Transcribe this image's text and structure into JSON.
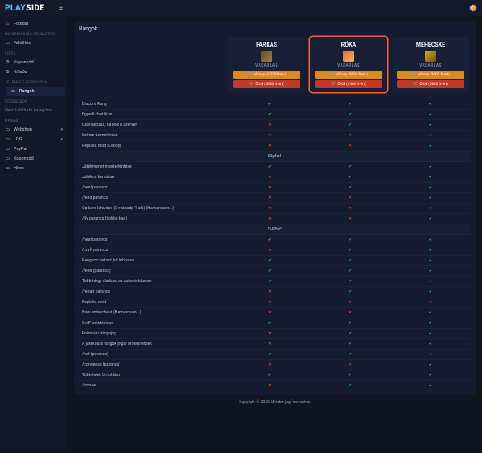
{
  "app": {
    "logo_a": "PLAY",
    "logo_b": "SIDE"
  },
  "sidebar": {
    "home": "Főoldal",
    "sec_info": "INFORMÁCIÓS FELÜLETEK",
    "feltoltes": "Feltöltés",
    "sec_lista": "LISTA",
    "kupon": "Kuponkód",
    "kulsos": "Külsős",
    "sec_kerdes": "JELENLEG KERESED A",
    "rangok": "Rangok",
    "sec_kategoria": "KERESÉSEK",
    "nem_talalhato": "Nem található kategória",
    "sec_vasar": "HASÁB",
    "webshop": "Webshop",
    "log": "LOG",
    "paypal": "PayPal",
    "kuponkod": "Kuponkód",
    "hirek": "Hírek"
  },
  "page": {
    "title": "Rangok"
  },
  "ranks": [
    {
      "name": "FARKAS",
      "sub": "VÁSÁRLÁS",
      "btn1": "60 nap (1500 ft-ért)",
      "btn2": "Örök (3400 ft-ért)"
    },
    {
      "name": "RÓKA",
      "sub": "VÁSÁRLÁS",
      "btn1": "60 nap (2000 ft-ért)",
      "btn2": "Örök (3400 ft-ért)"
    },
    {
      "name": "MÉHECSKE",
      "sub": "VÁSÁRLÁS",
      "btn1": "60 nap (3000 ft-ért)",
      "btn2": "Örök (5800 ft-ért)"
    }
  ],
  "rows1": [
    "Discord Rang",
    "Egyedi chat ikon",
    "Csatlakozás, ha tele a szerver",
    "Színes üzenet írása",
    "Repülés mód (Lobby)"
  ],
  "vals1": [
    [
      "y",
      "y",
      "y"
    ],
    [
      "y",
      "y",
      "y"
    ],
    [
      "n",
      "y",
      "y"
    ],
    [
      "n",
      "n",
      "y"
    ],
    [
      "n",
      "n",
      "y"
    ]
  ],
  "sec2": "SkyFall",
  "rows2": [
    "Játékmenet megterkintése",
    "Játékos keresése",
    "/heal parancs",
    "/feed parancs",
    "Op kard lehívása (5 másodp 1 alk) (Hamarosan...)",
    "/fly parancs (Lobby-ban)"
  ],
  "vals2": [
    [
      "y",
      "y",
      "y"
    ],
    [
      "n",
      "y",
      "y"
    ],
    [
      "n",
      "y",
      "y"
    ],
    [
      "n",
      "n",
      "y"
    ],
    [
      "n",
      "n",
      "n"
    ],
    [
      "n",
      "n",
      "y"
    ]
  ],
  "sec3": "FullPvP",
  "rows3": [
    "/heal parancs",
    "/craft parancs",
    "Ranghoz tartozó kit lehívása",
    "/feed (parancs)",
    "Több tárgy eladása az aukciósházban",
    "/repair parancs",
    "Repülés mód",
    "Napi enderchest (Hamarosan...)",
    "OnIP betekintése",
    "Prémium bányajog",
    "A játékosra rangok jogai örökölhetőek",
    "/hat (parancs)",
    "/condense (parancs)",
    "Több telek birtoklása",
    "/invsee"
  ],
  "vals3": [
    [
      "y",
      "y",
      "y"
    ],
    [
      "n",
      "y",
      "y"
    ],
    [
      "y",
      "y",
      "y"
    ],
    [
      "y",
      "y",
      "y"
    ],
    [
      "y",
      "y",
      "y"
    ],
    [
      "n",
      "y",
      "y"
    ],
    [
      "n",
      "n",
      "n"
    ],
    [
      "n",
      "n",
      "y"
    ],
    [
      "y",
      "y",
      "y"
    ],
    [
      "n",
      "y",
      "y"
    ],
    [
      "n",
      "y",
      "y"
    ],
    [
      "y",
      "y",
      "y"
    ],
    [
      "n",
      "n",
      "y"
    ],
    [
      "y",
      "y",
      "y"
    ],
    [
      "n",
      "y",
      "y"
    ]
  ],
  "footer": "Copyright © 2023 Minden jog fenntartva."
}
